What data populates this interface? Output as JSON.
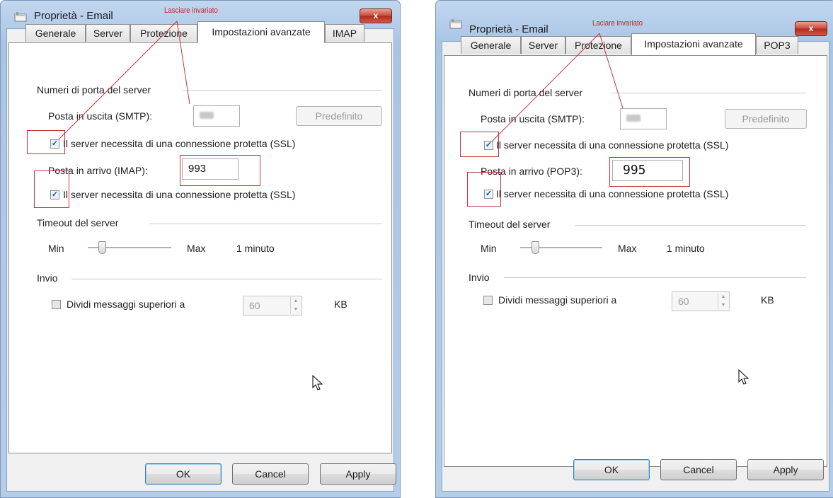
{
  "dialogs": [
    {
      "title": "Proprietà - Email",
      "close_label": "x",
      "annotation": "Lasciare invariato",
      "tabs": [
        "Generale",
        "Server",
        "Protezione",
        "Impostazioni avanzate",
        "IMAP"
      ],
      "active_tab": "Impostazioni avanzate",
      "server_ports_group": "Numeri di porta del server",
      "outgoing_label": "Posta in uscita (SMTP):",
      "outgoing_value": "",
      "default_button": "Predefinito",
      "ssl_label_1": "Il server necessita di una connessione protetta (SSL)",
      "ssl_checked_1": true,
      "incoming_label": "Posta in arrivo (IMAP):",
      "incoming_value": "993",
      "ssl_label_2": "Il server necessita di una connessione protetta (SSL)",
      "ssl_checked_2": true,
      "timeout_group": "Timeout del server",
      "timeout_min": "Min",
      "timeout_max": "Max",
      "timeout_value": "1 minuto",
      "timeout_level": 0.2,
      "send_group": "Invio",
      "split_label": "Dividi messaggi superiori a",
      "split_checked": false,
      "split_value": "60",
      "split_unit": "KB",
      "ok_label": "OK",
      "cancel_label": "Cancel",
      "apply_label": "Apply"
    },
    {
      "title": "Proprietà - Email",
      "close_label": "x",
      "annotation": "Laciare invariato",
      "tabs": [
        "Generale",
        "Server",
        "Protezione",
        "Impostazioni avanzate",
        "POP3"
      ],
      "active_tab": "Impostazioni avanzate",
      "server_ports_group": "Numeri di porta del server",
      "outgoing_label": "Posta in uscita (SMTP):",
      "outgoing_value": "",
      "default_button": "Predefinito",
      "ssl_label_1": "Il server necessita di una connessione protetta (SSL)",
      "ssl_checked_1": true,
      "incoming_label": "Posta in arrivo (POP3):",
      "incoming_value": "995",
      "ssl_label_2": "Il server necessita di una connessione protetta (SSL)",
      "ssl_checked_2": true,
      "timeout_group": "Timeout del server",
      "timeout_min": "Min",
      "timeout_max": "Max",
      "timeout_value": "1 minuto",
      "timeout_level": 0.2,
      "send_group": "Invio",
      "split_label": "Dividi messaggi superiori a",
      "split_checked": false,
      "split_value": "60",
      "split_unit": "KB",
      "ok_label": "OK",
      "cancel_label": "Cancel",
      "apply_label": "Apply"
    }
  ],
  "colors": {
    "annotation_red": "#c0262e",
    "titlebar_blue": "#b5cde9",
    "close_red": "#c9483a"
  }
}
